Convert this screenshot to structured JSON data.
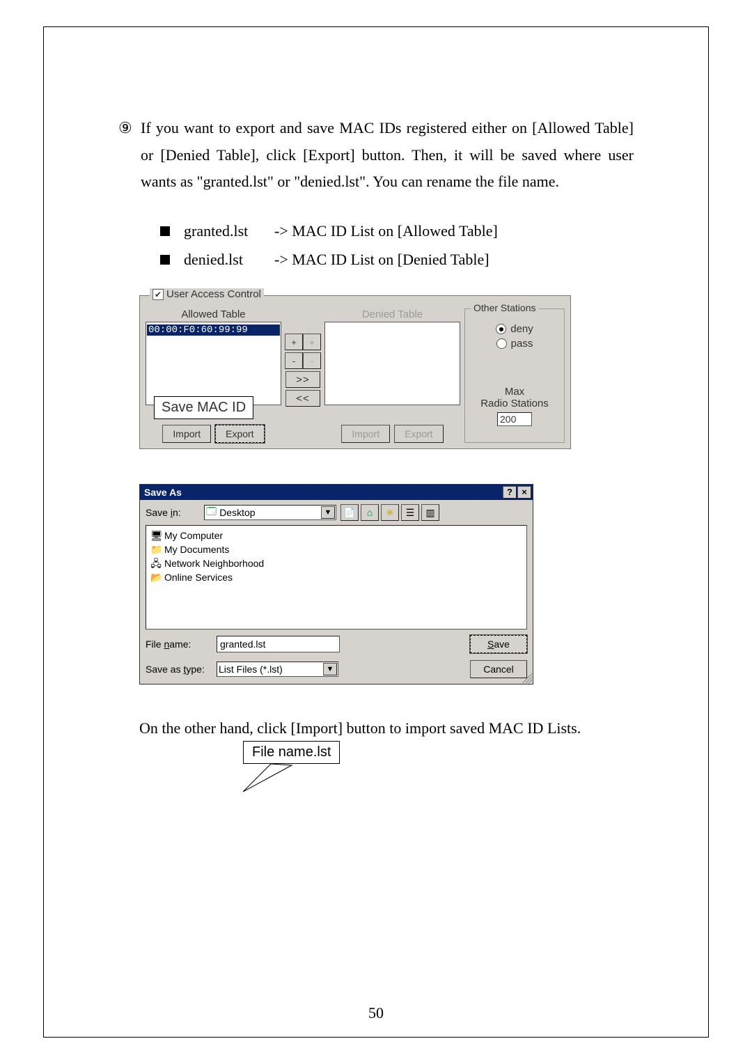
{
  "step_marker": "⑨",
  "step_text": "If you want to export and save MAC IDs registered either on [Allowed Table] or [Denied Table], click [Export] button. Then, it will be saved where user wants as \"granted.lst\" or \"denied.lst\". You can rename the file name.",
  "bullets": [
    {
      "label": "granted.lst",
      "desc": "-> MAC ID List on [Allowed Table]"
    },
    {
      "label": "denied.lst",
      "desc": "-> MAC ID List on [Denied Table]"
    }
  ],
  "uac": {
    "legend": "User Access Control",
    "allowed_title": "Allowed Table",
    "denied_title": "Denied Table",
    "selected_mac": "00:00:F0:60:99:99",
    "btn_plus": "+",
    "btn_minus": "-",
    "btn_move_right": ">>",
    "btn_move_left": "<<",
    "import": "Import",
    "export": "Export",
    "other_stations": "Other Stations",
    "radio_deny": "deny",
    "radio_pass": "pass",
    "max_label": "Max",
    "radio_stations": "Radio Stations",
    "max_value": "200",
    "callout": "Save MAC ID"
  },
  "saveas": {
    "title": "Save As",
    "save_in_label": "Save in:",
    "save_in_value": "Desktop",
    "items": [
      {
        "icon": "🖥",
        "name": "My Computer"
      },
      {
        "icon": "📁",
        "name": "My Documents"
      },
      {
        "icon": "🖧",
        "name": "Network Neighborhood"
      },
      {
        "icon": "📂",
        "name": "Online Services"
      }
    ],
    "file_name_label": "File name:",
    "file_name_value": "granted.lst",
    "save_as_type_label": "Save as type:",
    "save_as_type_value": "List Files (*.lst)",
    "save_btn": "Save",
    "cancel_btn": "Cancel",
    "callout": "File name.lst"
  },
  "closing_text": "On the other hand, click [Import] button to import saved MAC ID Lists.",
  "page_number": "50"
}
